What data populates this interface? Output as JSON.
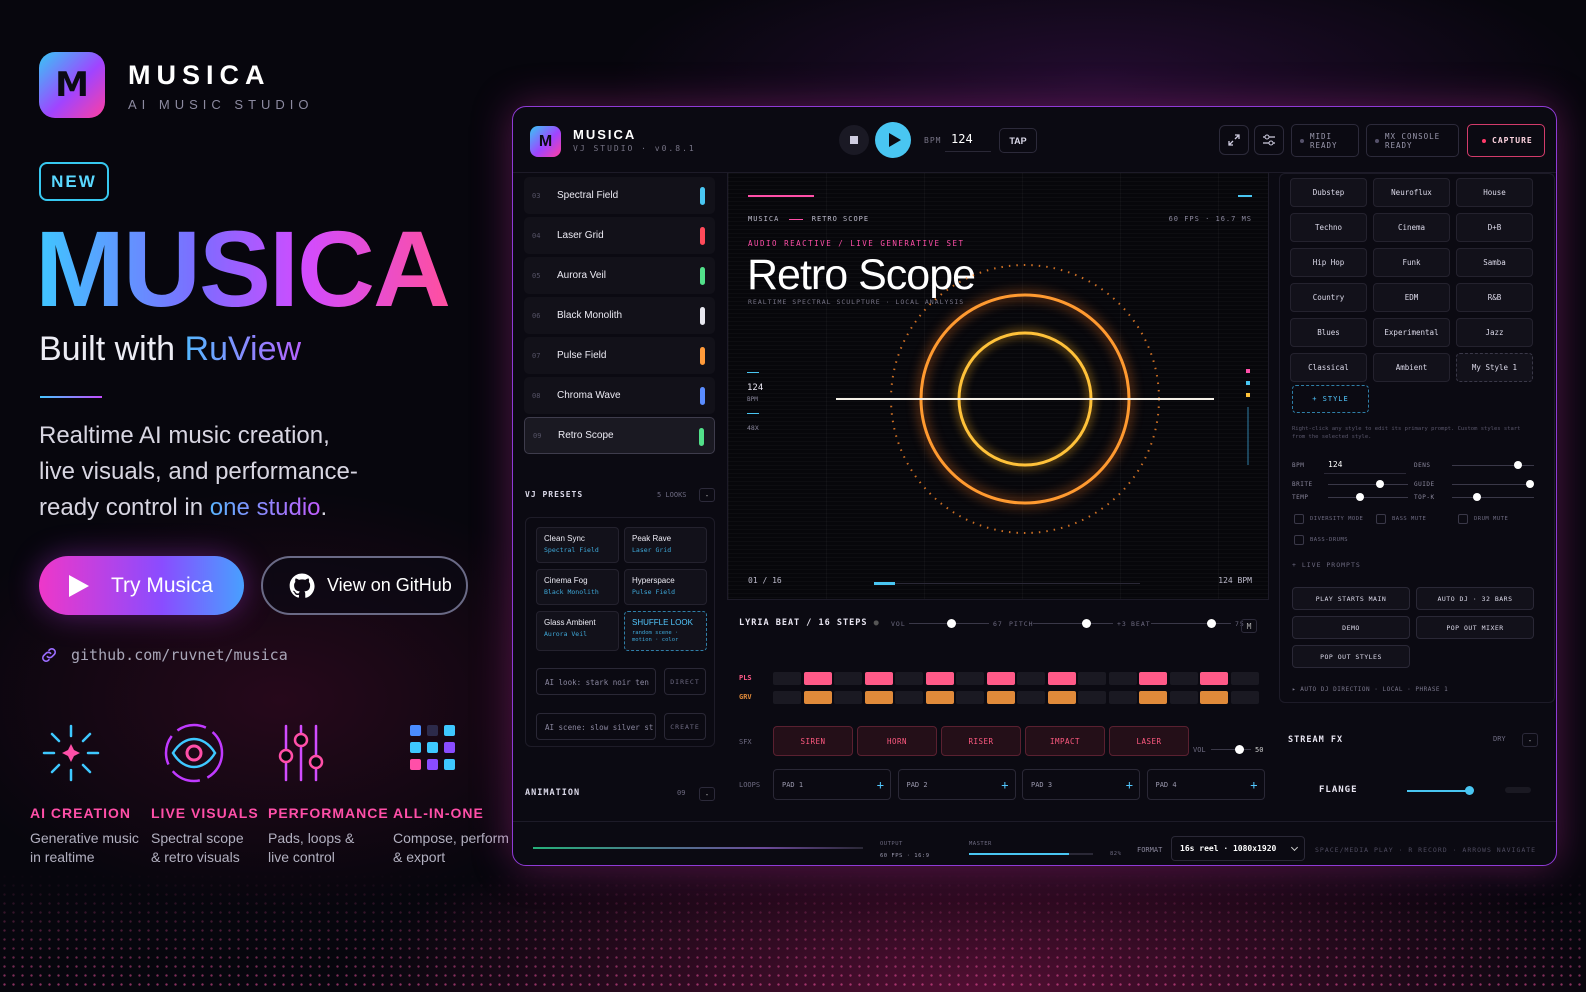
{
  "brand": {
    "logo_letter": "M",
    "name": "MUSICA",
    "tagline": "AI MUSIC STUDIO"
  },
  "hero": {
    "badge": "NEW",
    "title": "MUSICA",
    "built_prefix": "Built with",
    "built_highlight": "RuView",
    "desc_line1": "Realtime AI music creation,",
    "desc_line2": "live visuals, and performance-",
    "desc_line3_prefix": "ready control in",
    "desc_line3_highlight": "one studio",
    "desc_line3_suffix": ".",
    "try_label": "Try Musica",
    "github_label": "View on GitHub",
    "repo_link": "github.com/ruvnet/musica"
  },
  "features": [
    {
      "icon": "sparkle-icon",
      "title": "AI CREATION",
      "line1": "Generative music",
      "line2": "in realtime"
    },
    {
      "icon": "eye-icon",
      "title": "LIVE VISUALS",
      "line1": "Spectral scope",
      "line2": "& retro visuals"
    },
    {
      "icon": "sliders-icon",
      "title": "PERFORMANCE",
      "line1": "Pads, loops &",
      "line2": "live control"
    },
    {
      "icon": "grid-icon",
      "title": "ALL-IN-ONE",
      "line1": "Compose, perform",
      "line2": "& export"
    }
  ],
  "app": {
    "logo_letter": "M",
    "name": "MUSICA",
    "sub": "VJ STUDIO · v0.8.1",
    "bpm_label": "BPM",
    "bpm": "124",
    "tap": "TAP",
    "midi_l1": "MIDI",
    "midi_l2": "READY",
    "mx_l1": "MX CONSOLE",
    "mx_l2": "READY",
    "capture": "CAPTURE",
    "tracks": [
      {
        "n": "03",
        "name": "Spectral Field",
        "color": "#49c6f2"
      },
      {
        "n": "04",
        "name": "Laser Grid",
        "color": "#ff4a5a"
      },
      {
        "n": "05",
        "name": "Aurora Veil",
        "color": "#52e08a"
      },
      {
        "n": "06",
        "name": "Black Monolith",
        "color": "#e8e8f0"
      },
      {
        "n": "07",
        "name": "Pulse Field",
        "color": "#ff9a3a"
      },
      {
        "n": "08",
        "name": "Chroma Wave",
        "color": "#5a8cff"
      },
      {
        "n": "09",
        "name": "Retro Scope",
        "color": "#52e08a"
      }
    ],
    "vj_presets": {
      "title": "VJ PRESETS",
      "count": "5 LOOKS",
      "collapse": "-",
      "items": [
        {
          "a": "Clean Sync",
          "b": "Spectral Field"
        },
        {
          "a": "Peak Rave",
          "b": "Laser Grid"
        },
        {
          "a": "Cinema Fog",
          "b": "Black Monolith"
        },
        {
          "a": "Hyperspace",
          "b": "Pulse Field"
        },
        {
          "a": "Glass Ambient",
          "b": "Aurora Veil"
        },
        {
          "a": "SHUFFLE LOOK",
          "b": "random scene · motion · color"
        }
      ],
      "ai_look": "AI look: stark noir ten",
      "ai_look_btn": "DIRECT",
      "ai_scene": "AI scene: slow silver st",
      "ai_scene_btn": "CREATE"
    },
    "animation": {
      "label": "ANIMATION",
      "n": "09",
      "collapse": "-"
    },
    "visual": {
      "crumb_a": "MUSICA",
      "crumb_b": "RETRO SCOPE",
      "fps": "60 FPS · 16.7 MS",
      "tag": "AUDIO REACTIVE / LIVE GENERATIVE SET",
      "title": "Retro Scope",
      "subtitle": "REALTIME SPECTRAL SCULPTURE · LOCAL ANALYSIS",
      "bpm": "124",
      "bpm_unit": "BPM",
      "zoom": "48X",
      "frame": "01 / 16",
      "bpm_right": "124 BPM",
      "progress": 0.08
    },
    "beat": {
      "title": "LYRIA BEAT / 16 STEPS",
      "vol_label": "VOL",
      "vol": "67",
      "vol_level": 0.52,
      "pitch_label": "PITCH",
      "pitch": "+3",
      "pitch_level": 0.66,
      "beat_label": "BEAT",
      "beat": "75",
      "beat_level": 0.75,
      "m_btn": "M",
      "rows": [
        {
          "label": "PLS",
          "color": "#ff5a88",
          "steps": [
            0,
            1,
            0,
            1,
            0,
            1,
            0,
            1,
            0,
            1,
            0,
            0,
            1,
            0,
            1,
            0
          ]
        },
        {
          "label": "GRV",
          "color": "#e08a3a",
          "steps": [
            0,
            1,
            0,
            1,
            0,
            1,
            0,
            1,
            0,
            1,
            0,
            0,
            1,
            0,
            1,
            0
          ]
        }
      ],
      "sfx_label": "SFX",
      "sfx": [
        "SIREN",
        "HORN",
        "RISER",
        "IMPACT",
        "LASER"
      ],
      "sfx_vol_label": "VOL",
      "sfx_vol": "50",
      "sfx_vol_level": 0.7,
      "loops_label": "LOOPS",
      "pads": [
        "PAD 1",
        "PAD 2",
        "PAD 3",
        "PAD 4"
      ],
      "pad_add": "+"
    },
    "styles": {
      "genres": [
        "Dubstep",
        "Neuroflux",
        "House",
        "Techno",
        "Cinema",
        "D+B",
        "Hip Hop",
        "Funk",
        "Samba",
        "Country",
        "EDM",
        "R&B",
        "Blues",
        "Experimental",
        "Jazz",
        "Classical",
        "Ambient",
        "My Style 1"
      ],
      "add": "+ STYLE",
      "hint": "Right-click any style to edit its primary prompt. Custom styles start from the selected style.",
      "bpm_label": "BPM",
      "bpm": "124",
      "dens_label": "DENS",
      "dens_level": 0.8,
      "brite_label": "BRITE",
      "brite_level": 0.65,
      "guide_label": "GUIDE",
      "guide_level": 0.95,
      "temp_label": "TEMP",
      "temp_level": 0.4,
      "topk_label": "TOP-K",
      "topk_level": 0.3,
      "checks": [
        "DIVERSITY MODE",
        "BASS MUTE",
        "DRUM MUTE",
        "BASS-DRUMS"
      ],
      "live_prompts": "+ LIVE PROMPTS",
      "buttons": [
        "PLAY STARTS MAIN",
        "AUTO DJ · 32 BARS",
        "DEMO",
        "POP OUT MIXER",
        "POP OUT STYLES"
      ],
      "auto_line": "▸ AUTO DJ DIRECTION · LOCAL · PHRASE 1"
    },
    "stream_fx": {
      "title": "STREAM FX",
      "dry": "DRY",
      "collapse": "-",
      "effect": "FLANGE"
    },
    "bottom": {
      "output_label": "OUTPUT",
      "output_val": "60 FPS · 16:9",
      "master_label": "MASTER",
      "master_pct": "82%",
      "format_label": "FORMAT",
      "format": "16s reel · 1080x1920",
      "keys": "SPACE/MEDIA PLAY · R RECORD · ARROWS NAVIGATE"
    }
  }
}
